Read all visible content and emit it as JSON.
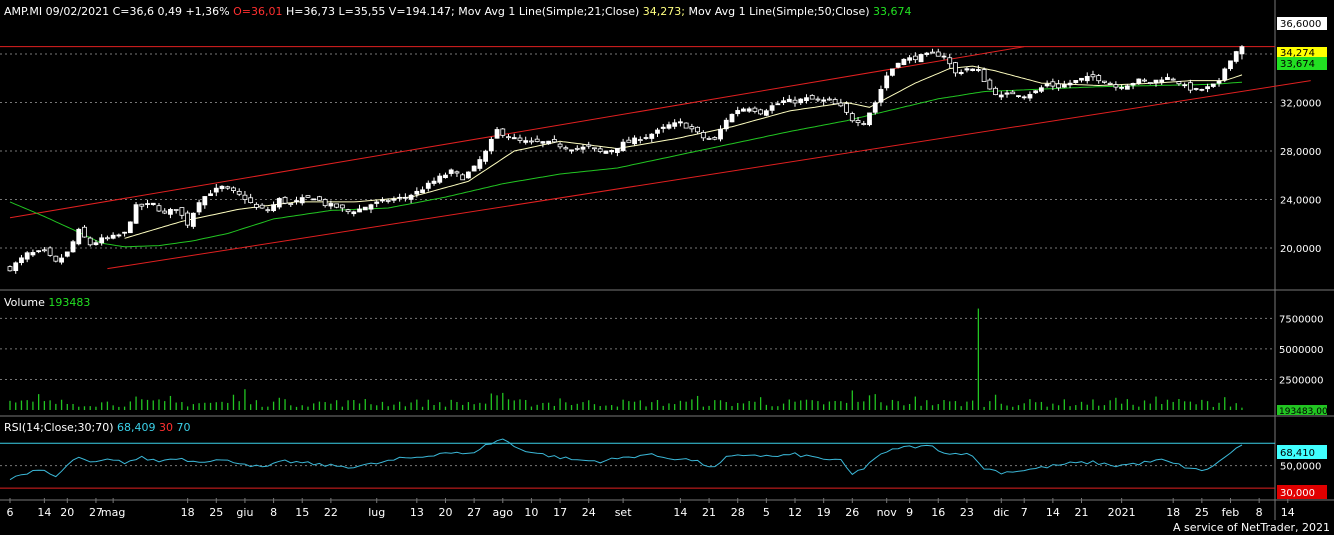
{
  "header": {
    "symbol": "AMP.MI",
    "date": "09/02/2021",
    "close_text": "C=36,6",
    "change_text": "0,49 +1,36%",
    "open_text": "O=36,01",
    "hlv_text": "H=36,73 L=35,55 V=194.147;",
    "ma21_label": "Mov Avg 1 Line(Simple;21;Close)",
    "ma21_value": "34,273;",
    "ma50_label": "Mov Avg 1 Line(Simple;50;Close)",
    "ma50_value": "33,674"
  },
  "volume_panel": {
    "label": "Volume",
    "value": "193483",
    "badge": "193483,00"
  },
  "rsi_panel": {
    "label": "RSI(14;Close;30;70)",
    "value": "68,409",
    "low": "30",
    "high": "70"
  },
  "price_badges": {
    "last": "36,6000",
    "ma21": "34,274",
    "ma50": "33,674"
  },
  "rsi_badges": {
    "value": "68,410",
    "low": "30,000"
  },
  "footer": "A service of NetTrader, 2021",
  "colors": {
    "background": "#000000",
    "candle_up": "#ffffff",
    "ma21": "#ffffc0",
    "ma50": "#22c522",
    "volume": "#22c522",
    "trendline": "#e02020",
    "rsi": "#3bb8d8",
    "rsi_bands": "#e02020",
    "grid": "#777777",
    "text": "#ffffff",
    "header_open": "#ff3030",
    "header_value_green": "#22e022"
  },
  "chart_data": {
    "type": "candlestick",
    "price_axis": {
      "ticks": [
        20,
        24,
        28,
        32,
        36
      ],
      "tick_labels": [
        "20,0000",
        "24,0000",
        "28,0000",
        "32,0000",
        "36,0000"
      ],
      "range": [
        17.2,
        38.8
      ]
    },
    "volume_axis": {
      "ticks": [
        2500000,
        5000000,
        7500000
      ],
      "tick_labels": [
        "2500000",
        "5000000",
        "7500000"
      ],
      "range": [
        0,
        9000000
      ]
    },
    "rsi_axis": {
      "ticks": [
        50
      ],
      "tick_labels": [
        "50,0000"
      ],
      "bands": [
        30,
        70
      ],
      "range": [
        23,
        80
      ]
    },
    "x_labels": [
      {
        "label": "6",
        "d": 0
      },
      {
        "label": "14",
        "d": 6
      },
      {
        "label": "20",
        "d": 10
      },
      {
        "label": "27",
        "d": 15
      },
      {
        "label": "mag",
        "d": 18
      },
      {
        "label": "18",
        "d": 31
      },
      {
        "label": "25",
        "d": 36
      },
      {
        "label": "giu",
        "d": 41
      },
      {
        "label": "8",
        "d": 46
      },
      {
        "label": "15",
        "d": 51
      },
      {
        "label": "22",
        "d": 56
      },
      {
        "label": "lug",
        "d": 64
      },
      {
        "label": "13",
        "d": 71
      },
      {
        "label": "20",
        "d": 76
      },
      {
        "label": "27",
        "d": 81
      },
      {
        "label": "ago",
        "d": 86
      },
      {
        "label": "10",
        "d": 91
      },
      {
        "label": "17",
        "d": 96
      },
      {
        "label": "24",
        "d": 101
      },
      {
        "label": "set",
        "d": 107
      },
      {
        "label": "14",
        "d": 117
      },
      {
        "label": "21",
        "d": 122
      },
      {
        "label": "28",
        "d": 127
      },
      {
        "label": "5",
        "d": 132
      },
      {
        "label": "12",
        "d": 137
      },
      {
        "label": "19",
        "d": 142
      },
      {
        "label": "26",
        "d": 147
      },
      {
        "label": "nov",
        "d": 153
      },
      {
        "label": "9",
        "d": 157
      },
      {
        "label": "16",
        "d": 162
      },
      {
        "label": "23",
        "d": 167
      },
      {
        "label": "dic",
        "d": 173
      },
      {
        "label": "7",
        "d": 177
      },
      {
        "label": "14",
        "d": 182
      },
      {
        "label": "21",
        "d": 187
      },
      {
        "label": "2021",
        "d": 194
      },
      {
        "label": "18",
        "d": 203
      },
      {
        "label": "25",
        "d": 208
      },
      {
        "label": "feb",
        "d": 213
      },
      {
        "label": "8",
        "d": 218
      },
      {
        "label": "14",
        "d": 223
      }
    ],
    "close_anchors": [
      [
        0,
        18.3
      ],
      [
        3,
        19.5
      ],
      [
        6,
        19.7
      ],
      [
        8,
        18.8
      ],
      [
        10,
        19.6
      ],
      [
        12,
        21.4
      ],
      [
        14,
        20.3
      ],
      [
        16,
        20.7
      ],
      [
        18,
        20.9
      ],
      [
        20,
        21.2
      ],
      [
        22,
        23.4
      ],
      [
        25,
        23.6
      ],
      [
        27,
        22.8
      ],
      [
        29,
        23.3
      ],
      [
        31,
        22.0
      ],
      [
        33,
        23.9
      ],
      [
        35,
        24.6
      ],
      [
        37,
        25.0
      ],
      [
        39,
        24.6
      ],
      [
        41,
        24.1
      ],
      [
        43,
        23.3
      ],
      [
        45,
        23.1
      ],
      [
        47,
        24.0
      ],
      [
        49,
        23.6
      ],
      [
        51,
        24.0
      ],
      [
        53,
        24.2
      ],
      [
        55,
        23.6
      ],
      [
        57,
        23.4
      ],
      [
        59,
        23.0
      ],
      [
        61,
        23.2
      ],
      [
        63,
        23.6
      ],
      [
        65,
        23.8
      ],
      [
        67,
        24.0
      ],
      [
        69,
        24.2
      ],
      [
        71,
        24.6
      ],
      [
        73,
        25.2
      ],
      [
        75,
        25.8
      ],
      [
        77,
        26.3
      ],
      [
        79,
        25.8
      ],
      [
        81,
        26.6
      ],
      [
        83,
        27.9
      ],
      [
        85,
        29.7
      ],
      [
        87,
        29.2
      ],
      [
        89,
        28.8
      ],
      [
        91,
        28.7
      ],
      [
        93,
        28.7
      ],
      [
        95,
        28.6
      ],
      [
        97,
        28.3
      ],
      [
        99,
        28.2
      ],
      [
        101,
        28.3
      ],
      [
        103,
        27.9
      ],
      [
        105,
        28.1
      ],
      [
        107,
        28.6
      ],
      [
        109,
        28.9
      ],
      [
        111,
        29.2
      ],
      [
        113,
        29.6
      ],
      [
        115,
        30.1
      ],
      [
        117,
        30.3
      ],
      [
        119,
        29.8
      ],
      [
        121,
        29.1
      ],
      [
        123,
        28.9
      ],
      [
        125,
        30.6
      ],
      [
        127,
        31.4
      ],
      [
        129,
        31.6
      ],
      [
        131,
        31.2
      ],
      [
        133,
        31.7
      ],
      [
        135,
        32.1
      ],
      [
        137,
        32.1
      ],
      [
        139,
        32.3
      ],
      [
        141,
        32.2
      ],
      [
        143,
        32.1
      ],
      [
        145,
        31.6
      ],
      [
        147,
        30.6
      ],
      [
        149,
        30.4
      ],
      [
        151,
        32.0
      ],
      [
        153,
        34.2
      ],
      [
        155,
        35.4
      ],
      [
        157,
        35.6
      ],
      [
        159,
        35.8
      ],
      [
        161,
        36.0
      ],
      [
        163,
        35.9
      ],
      [
        165,
        34.4
      ],
      [
        167,
        34.8
      ],
      [
        169,
        34.6
      ],
      [
        171,
        33.1
      ],
      [
        173,
        32.5
      ],
      [
        175,
        32.8
      ],
      [
        177,
        32.6
      ],
      [
        179,
        32.9
      ],
      [
        181,
        33.5
      ],
      [
        183,
        33.3
      ],
      [
        185,
        33.6
      ],
      [
        187,
        33.9
      ],
      [
        189,
        34.1
      ],
      [
        191,
        33.8
      ],
      [
        193,
        33.3
      ],
      [
        195,
        33.5
      ],
      [
        197,
        33.8
      ],
      [
        199,
        33.6
      ],
      [
        201,
        34.0
      ],
      [
        203,
        34.0
      ],
      [
        205,
        33.3
      ],
      [
        207,
        33.0
      ],
      [
        209,
        33.2
      ],
      [
        211,
        33.6
      ],
      [
        212,
        34.8
      ],
      [
        213,
        35.6
      ],
      [
        214,
        36.2
      ],
      [
        215,
        36.6
      ]
    ],
    "ma21_anchors": [
      [
        20,
        20.8
      ],
      [
        30,
        22.2
      ],
      [
        40,
        23.2
      ],
      [
        50,
        23.8
      ],
      [
        60,
        23.8
      ],
      [
        70,
        24.2
      ],
      [
        80,
        25.5
      ],
      [
        88,
        28.0
      ],
      [
        96,
        28.8
      ],
      [
        106,
        28.2
      ],
      [
        116,
        29.0
      ],
      [
        126,
        30.0
      ],
      [
        136,
        31.3
      ],
      [
        146,
        32.0
      ],
      [
        150,
        31.6
      ],
      [
        158,
        33.6
      ],
      [
        164,
        34.8
      ],
      [
        168,
        35.0
      ],
      [
        172,
        34.6
      ],
      [
        180,
        33.6
      ],
      [
        190,
        33.4
      ],
      [
        200,
        33.6
      ],
      [
        206,
        33.8
      ],
      [
        212,
        33.8
      ],
      [
        215,
        34.27
      ]
    ],
    "ma50_anchors": [
      [
        0,
        23.8
      ],
      [
        6,
        22.6
      ],
      [
        12,
        21.3
      ],
      [
        16,
        20.4
      ],
      [
        20,
        20.1
      ],
      [
        26,
        20.2
      ],
      [
        32,
        20.6
      ],
      [
        38,
        21.2
      ],
      [
        46,
        22.4
      ],
      [
        56,
        23.1
      ],
      [
        66,
        23.3
      ],
      [
        76,
        24.2
      ],
      [
        86,
        25.3
      ],
      [
        96,
        26.1
      ],
      [
        106,
        26.6
      ],
      [
        116,
        27.6
      ],
      [
        126,
        28.6
      ],
      [
        136,
        29.6
      ],
      [
        146,
        30.5
      ],
      [
        154,
        31.4
      ],
      [
        162,
        32.3
      ],
      [
        170,
        32.9
      ],
      [
        180,
        33.1
      ],
      [
        190,
        33.3
      ],
      [
        200,
        33.4
      ],
      [
        210,
        33.5
      ],
      [
        215,
        33.67
      ]
    ],
    "rsi_anchors": [
      [
        0,
        38
      ],
      [
        3,
        44
      ],
      [
        6,
        45
      ],
      [
        8,
        40
      ],
      [
        10,
        50
      ],
      [
        12,
        58
      ],
      [
        14,
        52
      ],
      [
        17,
        55
      ],
      [
        20,
        53
      ],
      [
        23,
        57
      ],
      [
        26,
        54
      ],
      [
        29,
        57
      ],
      [
        32,
        54
      ],
      [
        36,
        55
      ],
      [
        40,
        53
      ],
      [
        44,
        48
      ],
      [
        48,
        54
      ],
      [
        52,
        52
      ],
      [
        56,
        50
      ],
      [
        60,
        49
      ],
      [
        64,
        52
      ],
      [
        68,
        56
      ],
      [
        72,
        58
      ],
      [
        76,
        62
      ],
      [
        80,
        60
      ],
      [
        83,
        68
      ],
      [
        86,
        74
      ],
      [
        88,
        67
      ],
      [
        91,
        62
      ],
      [
        95,
        58
      ],
      [
        99,
        55
      ],
      [
        103,
        54
      ],
      [
        107,
        57
      ],
      [
        111,
        60
      ],
      [
        115,
        57
      ],
      [
        119,
        55
      ],
      [
        123,
        48
      ],
      [
        125,
        57
      ],
      [
        129,
        60
      ],
      [
        133,
        58
      ],
      [
        137,
        60
      ],
      [
        141,
        57
      ],
      [
        145,
        54
      ],
      [
        147,
        42
      ],
      [
        149,
        48
      ],
      [
        151,
        57
      ],
      [
        155,
        66
      ],
      [
        158,
        67
      ],
      [
        161,
        67
      ],
      [
        164,
        60
      ],
      [
        167,
        62
      ],
      [
        170,
        48
      ],
      [
        173,
        44
      ],
      [
        177,
        46
      ],
      [
        181,
        49
      ],
      [
        185,
        52
      ],
      [
        189,
        53
      ],
      [
        193,
        50
      ],
      [
        197,
        52
      ],
      [
        201,
        55
      ],
      [
        205,
        49
      ],
      [
        208,
        45
      ],
      [
        211,
        53
      ],
      [
        213,
        62
      ],
      [
        215,
        68.4
      ]
    ],
    "volume_spikes": {
      "d": [
        5,
        22,
        28,
        39,
        41,
        47,
        62,
        84,
        85,
        86,
        96,
        120,
        131,
        147,
        150,
        151,
        158,
        169,
        172,
        193,
        200,
        204,
        212,
        215
      ],
      "v": [
        1300000,
        1100000,
        1150000,
        1250000,
        1700000,
        1000000,
        900000,
        1350000,
        1200000,
        1400000,
        950000,
        1150000,
        1050000,
        1600000,
        1200000,
        1300000,
        1100000,
        8300000,
        1250000,
        1000000,
        1100000,
        900000,
        1050000,
        193483
      ]
    },
    "channel_upper": [
      [
        0,
        22.5
      ],
      [
        177,
        36.6
      ]
    ],
    "channel_lower": [
      [
        17,
        18.3
      ],
      [
        227,
        33.8
      ]
    ],
    "price_last_line": 36.6,
    "last_close": 36.6,
    "last_open": 36.01,
    "last_high": 36.73,
    "last_low": 35.55,
    "last_volume": 194147
  }
}
